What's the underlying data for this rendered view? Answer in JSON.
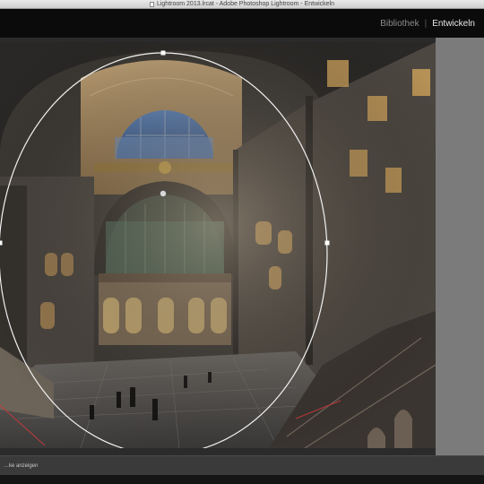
{
  "window": {
    "title": "Lightroom 2013.lrcat - Adobe Photoshop Lightroom - Entwickeln"
  },
  "modules": {
    "library": "Bibliothek",
    "separator": "|",
    "develop": "Entwickeln",
    "active": "develop"
  },
  "toolbar": {
    "hint": "…ke anzeigen"
  },
  "tool": {
    "name": "radial-filter",
    "icon": "ellipse-handles-icon"
  },
  "colors": {
    "title_bar": "#dcdcdc",
    "module_bar": "#0b0b0b",
    "module_active": "#e8e8e8",
    "module_inactive": "#8c8c8c",
    "side_panel": "#7b7b7b",
    "workarea": "#2b2b2b"
  }
}
